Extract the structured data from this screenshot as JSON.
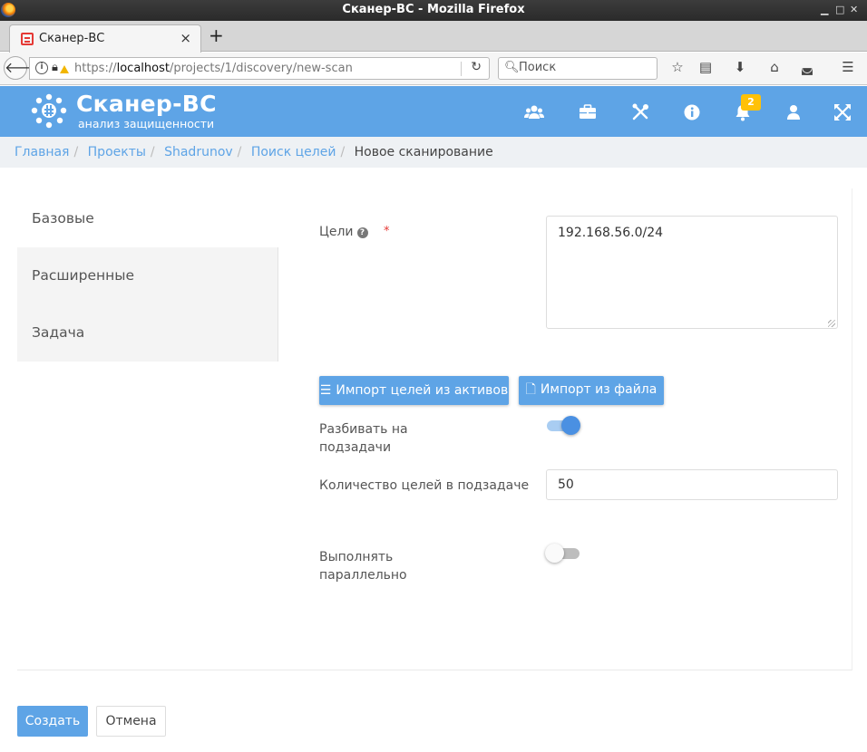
{
  "window": {
    "title": "Сканер-ВС - Mozilla Firefox"
  },
  "browser": {
    "tab_title": "Сканер-ВС",
    "tab_close": "×",
    "new_tab": "+",
    "url_prefix": "https://",
    "url_host": "localhost",
    "url_path": "/projects/1/discovery/new-scan",
    "search_placeholder": "Поиск"
  },
  "app": {
    "logo_name": "Сканер-ВС",
    "logo_subtitle": "анализ защищенности",
    "notification_count": "2",
    "header_icons": [
      "users-icon",
      "briefcase-icon",
      "tools-icon",
      "info-icon",
      "bell-icon",
      "user-icon",
      "fullscreen-icon"
    ]
  },
  "breadcrumb": {
    "items": [
      "Главная",
      "Проекты",
      "Shadrunov",
      "Поиск целей"
    ],
    "active": "Новое сканирование"
  },
  "sidenav": {
    "items": [
      "Базовые",
      "Расширенные",
      "Задача"
    ]
  },
  "form": {
    "targets_label": "Цели",
    "required_mark": "*",
    "targets_value": "192.168.56.0/24",
    "import_assets_label": "Импорт целей из активов",
    "import_file_label": "Импорт из файла",
    "split_label_line1": "Разбивать на",
    "split_label_line2": "подзадачи",
    "split_enabled": true,
    "count_label": "Количество целей в подзадаче",
    "count_value": "50",
    "parallel_label_line1": "Выполнять",
    "parallel_label_line2": "параллельно",
    "parallel_enabled": false
  },
  "actions": {
    "create_label": "Создать",
    "cancel_label": "Отмена"
  },
  "colors": {
    "brand": "#5ea4e6",
    "badge": "#ffc107",
    "required": "#e53935"
  }
}
